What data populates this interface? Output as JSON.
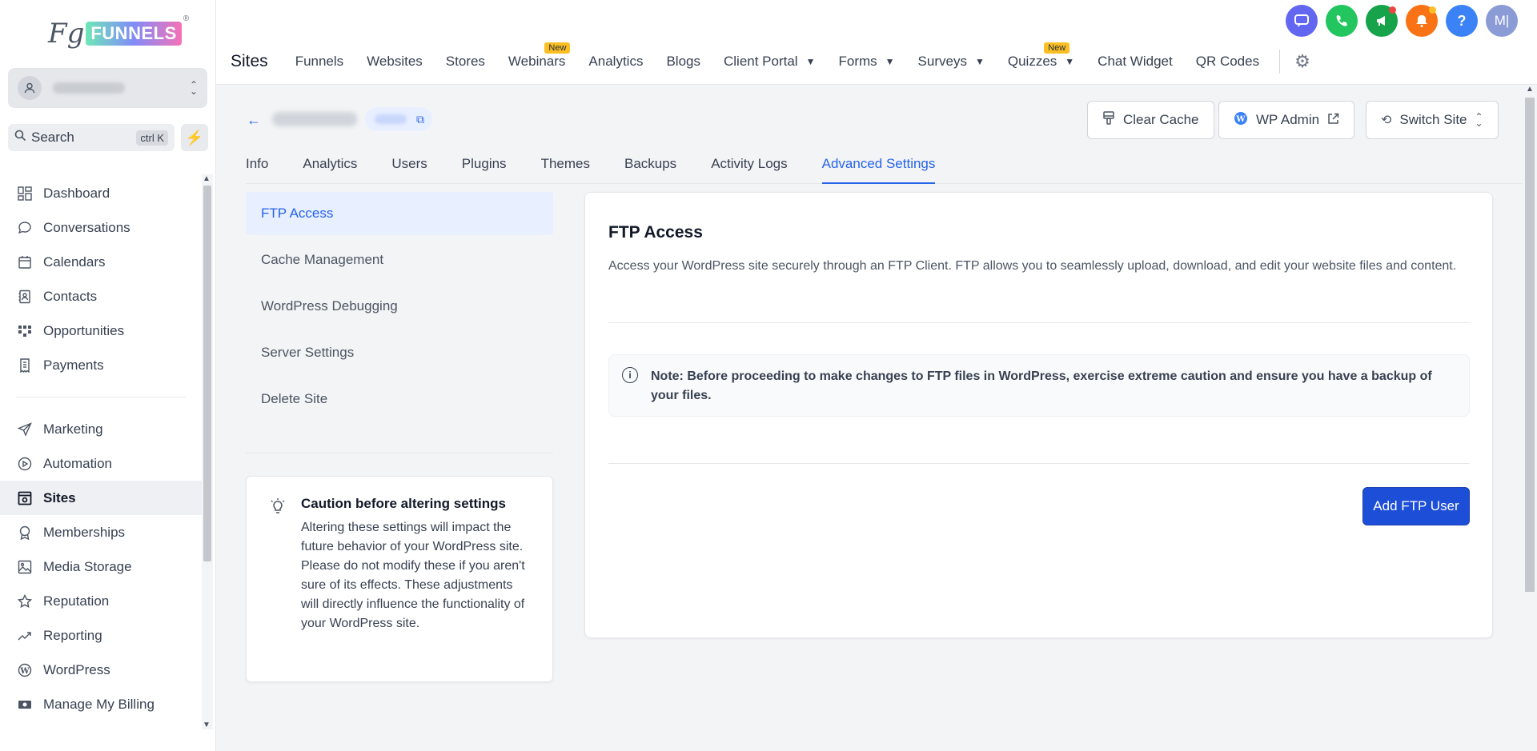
{
  "logo": {
    "prefix": "Fg",
    "brand": "FUNNELS",
    "reg": "®"
  },
  "search": {
    "label": "Search",
    "shortcut": "ctrl K"
  },
  "sidebar": {
    "items": [
      {
        "label": "Dashboard",
        "icon": "dashboard-icon"
      },
      {
        "label": "Conversations",
        "icon": "chat-bubble-icon"
      },
      {
        "label": "Calendars",
        "icon": "calendar-icon"
      },
      {
        "label": "Contacts",
        "icon": "contacts-icon"
      },
      {
        "label": "Opportunities",
        "icon": "opportunities-icon"
      },
      {
        "label": "Payments",
        "icon": "receipt-icon"
      },
      {
        "label": "Marketing",
        "icon": "send-icon"
      },
      {
        "label": "Automation",
        "icon": "automation-icon"
      },
      {
        "label": "Sites",
        "icon": "sites-icon"
      },
      {
        "label": "Memberships",
        "icon": "badge-icon"
      },
      {
        "label": "Media Storage",
        "icon": "image-icon"
      },
      {
        "label": "Reputation",
        "icon": "star-icon"
      },
      {
        "label": "Reporting",
        "icon": "trend-icon"
      },
      {
        "label": "WordPress",
        "icon": "wordpress-icon"
      },
      {
        "label": "Manage My Billing",
        "icon": "billing-icon"
      }
    ]
  },
  "topbar": {
    "section_title": "Sites",
    "tabs": [
      {
        "label": "Funnels"
      },
      {
        "label": "Websites"
      },
      {
        "label": "Stores"
      },
      {
        "label": "Webinars",
        "badge": "New"
      },
      {
        "label": "Analytics"
      },
      {
        "label": "Blogs"
      },
      {
        "label": "Client Portal"
      },
      {
        "label": "Forms"
      },
      {
        "label": "Surveys"
      },
      {
        "label": "Quizzes",
        "badge": "New"
      },
      {
        "label": "Chat Widget"
      },
      {
        "label": "QR Codes"
      }
    ],
    "icons": [
      {
        "name": "chat-icon",
        "color": "#6366f1"
      },
      {
        "name": "phone-icon",
        "color": "#22c55e"
      },
      {
        "name": "megaphone-icon",
        "color": "#16a34a"
      },
      {
        "name": "bell-icon",
        "color": "#f97316"
      },
      {
        "name": "help-icon",
        "color": "#3b82f6"
      }
    ],
    "user_initials": "M|"
  },
  "actions": {
    "clear_cache": "Clear Cache",
    "wp_admin": "WP Admin",
    "switch_site": "Switch Site"
  },
  "subtabs": [
    "Info",
    "Analytics",
    "Users",
    "Plugins",
    "Themes",
    "Backups",
    "Activity Logs",
    "Advanced Settings"
  ],
  "advanced_nav": [
    "FTP Access",
    "Cache Management",
    "WordPress Debugging",
    "Server Settings",
    "Delete Site"
  ],
  "caution": {
    "title": "Caution before altering settings",
    "text": "Altering these settings will impact the future behavior of your WordPress site. Please do not modify these if you aren't sure of its effects. These adjustments will directly influence the functionality of your WordPress site."
  },
  "ftp": {
    "title": "FTP Access",
    "description": "Access your WordPress site securely through an FTP Client. FTP allows you to seamlessly upload, download, and edit your website files and content.",
    "note": "Note: Before proceeding to make changes to FTP files in WordPress, exercise extreme caution and ensure you have a backup of your files.",
    "add_button": "Add FTP User"
  },
  "colors": {
    "accent": "#2563eb",
    "primary_button": "#1d4ed8"
  }
}
